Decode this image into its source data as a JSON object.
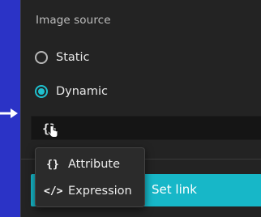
{
  "section": {
    "title": "Image source"
  },
  "options": {
    "static_label": "Static",
    "dynamic_label": "Dynamic",
    "selected": "Dynamic"
  },
  "field": {
    "brace_icon": "{}"
  },
  "menu": {
    "items": [
      {
        "icon": "{}",
        "label": "Attribute"
      },
      {
        "icon": "</>",
        "label": "Expression"
      }
    ]
  },
  "button": {
    "label_visible": "Set link"
  },
  "colors": {
    "accent": "#17b7c8",
    "panel": "#232323",
    "background": "#2b33c6"
  }
}
